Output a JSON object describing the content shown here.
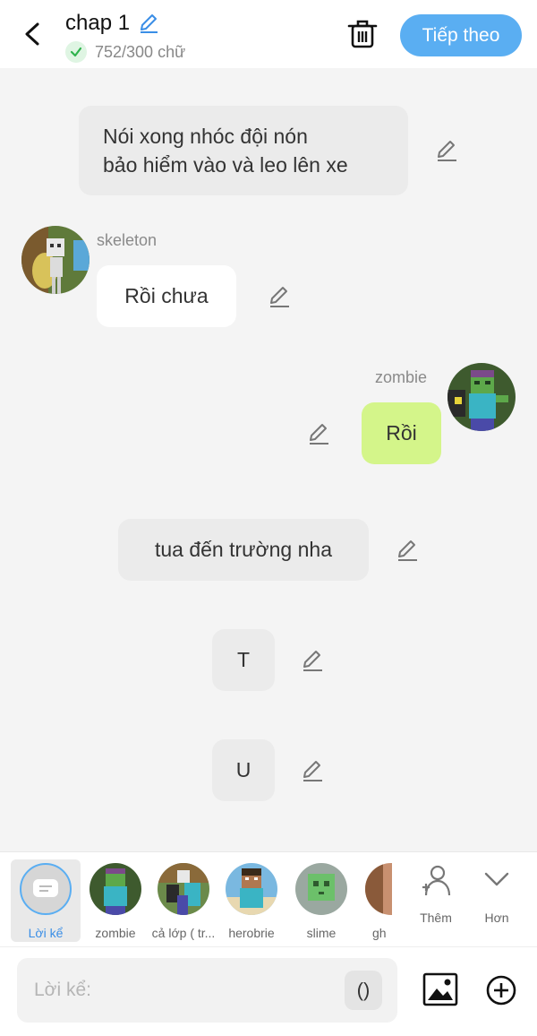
{
  "header": {
    "title": "chap 1",
    "word_count": "752/300 chữ",
    "next_label": "Tiếp theo"
  },
  "messages": [
    {
      "type": "narration",
      "text_line1": "Nói xong nhóc đội nón",
      "text_line2": "bảo hiểm vào và leo lên xe"
    },
    {
      "type": "character",
      "name": "skeleton",
      "text": "Rồi chưa"
    },
    {
      "type": "character",
      "name": "zombie",
      "text": "Rồi"
    },
    {
      "type": "narration",
      "text": "tua đến trường nha"
    },
    {
      "type": "narration",
      "text": "T"
    },
    {
      "type": "narration",
      "text": "U"
    }
  ],
  "characters": [
    {
      "label": "Lời kể",
      "selected": true
    },
    {
      "label": "zombie"
    },
    {
      "label": "cả lớp ( tr..."
    },
    {
      "label": "herobrie"
    },
    {
      "label": "slime"
    },
    {
      "label": "gh"
    }
  ],
  "actions": {
    "more_label": "Thêm",
    "collapse_label": "Hơn"
  },
  "composer": {
    "placeholder": "Lời kể:",
    "paren_label": "()"
  },
  "colors": {
    "accent": "#5aaef2",
    "own_bubble": "#d4f58a",
    "check": "#2fb34d"
  }
}
